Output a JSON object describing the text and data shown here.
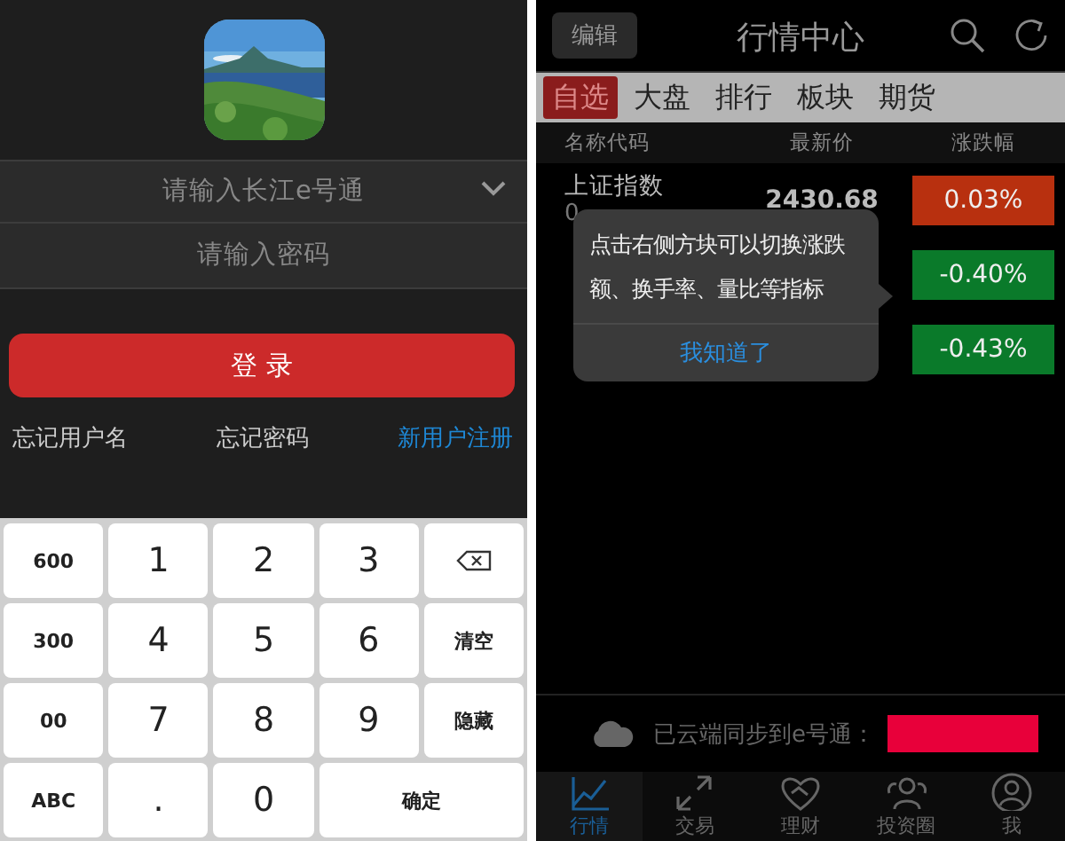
{
  "login": {
    "username": {
      "placeholder": "请输入长江e号通"
    },
    "password": {
      "placeholder": "请输入密码"
    },
    "login_button": "登 录",
    "links": [
      {
        "label": "忘记用户名",
        "kind": "plain"
      },
      {
        "label": "忘记密码",
        "kind": "plain"
      },
      {
        "label": "新用户注册",
        "kind": "accent"
      }
    ],
    "keypad": [
      {
        "label": "600",
        "kind": "function"
      },
      {
        "label": "1",
        "kind": "digit"
      },
      {
        "label": "2",
        "kind": "digit"
      },
      {
        "label": "3",
        "kind": "digit"
      },
      {
        "kind": "backspace"
      },
      {
        "label": "300",
        "kind": "function"
      },
      {
        "label": "4",
        "kind": "digit"
      },
      {
        "label": "5",
        "kind": "digit"
      },
      {
        "label": "6",
        "kind": "digit"
      },
      {
        "label": "清空",
        "kind": "function"
      },
      {
        "label": "00",
        "kind": "function"
      },
      {
        "label": "7",
        "kind": "digit"
      },
      {
        "label": "8",
        "kind": "digit"
      },
      {
        "label": "9",
        "kind": "digit"
      },
      {
        "label": "隐藏",
        "kind": "function"
      },
      {
        "label": "ABC",
        "kind": "function"
      },
      {
        "label": ".",
        "kind": "digit"
      },
      {
        "label": "0",
        "kind": "digit"
      },
      {
        "label": "确定",
        "kind": "wide"
      }
    ]
  },
  "market": {
    "edit_button": "编辑",
    "title": "行情中心",
    "tabs": [
      {
        "label": "自选",
        "selected": true
      },
      {
        "label": "大盘",
        "selected": false
      },
      {
        "label": "排行",
        "selected": false
      },
      {
        "label": "板块",
        "selected": false
      },
      {
        "label": "期货",
        "selected": false
      }
    ],
    "columns": [
      "名称代码",
      "最新价",
      "涨跌幅"
    ],
    "rows": [
      {
        "name": "上证指数",
        "code": "0",
        "price": "2430.68",
        "change": "0.03%",
        "color": "#b8300f"
      },
      {
        "change": "-0.40%",
        "color": "#0a7a2a"
      },
      {
        "change": "-0.43%",
        "color": "#0a7a2a"
      }
    ],
    "tooltip": {
      "message": "点击右侧方块可以切换涨跌额、换手率、量比等指标",
      "action": "我知道了"
    },
    "sync": {
      "text": "已云端同步到e号通："
    },
    "nav": [
      {
        "label": "行情",
        "selected": true
      },
      {
        "label": "交易",
        "selected": false
      },
      {
        "label": "理财",
        "selected": false
      },
      {
        "label": "投资圈",
        "selected": false
      },
      {
        "label": "我",
        "selected": false
      }
    ]
  }
}
